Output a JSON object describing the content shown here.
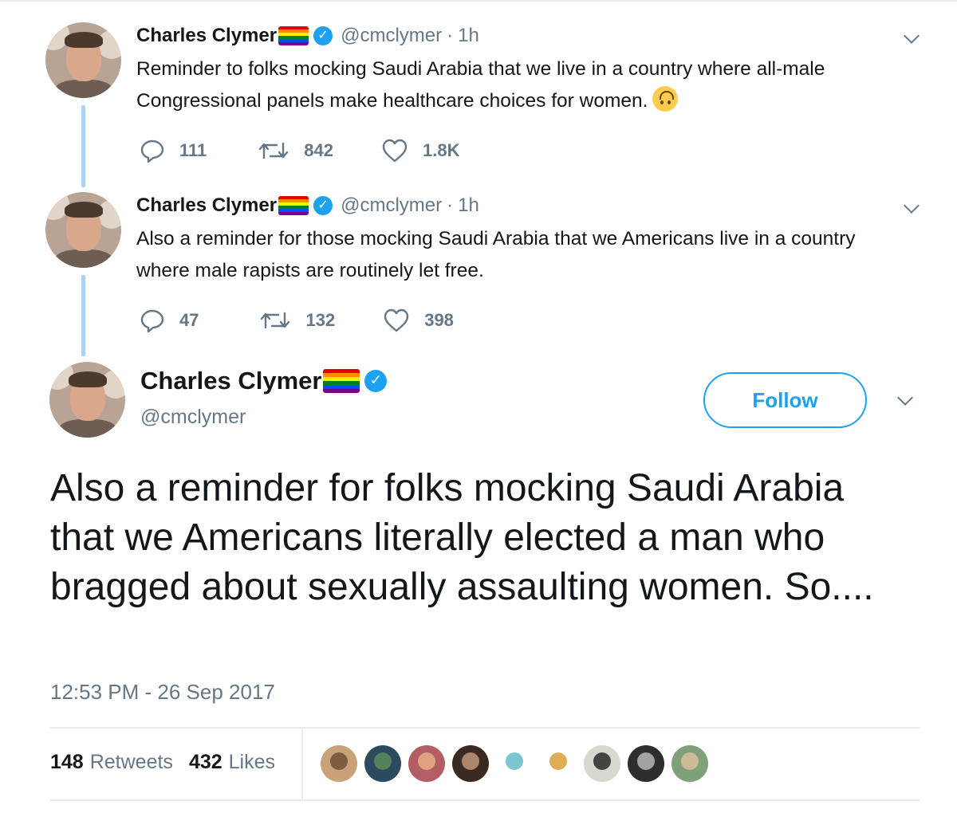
{
  "thread": [
    {
      "name": "Charles Clymer",
      "handle": "@cmclymer",
      "time": "1h",
      "text": "Reminder to folks mocking Saudi Arabia that we live in a country where all-male Congressional panels make healthcare choices for women.",
      "replies": "111",
      "retweets": "842",
      "likes": "1.8K"
    },
    {
      "name": "Charles Clymer",
      "handle": "@cmclymer",
      "time": "1h",
      "text": "Also a reminder for those mocking Saudi Arabia that we Americans live in a country where male rapists are routinely let free.",
      "replies": "47",
      "retweets": "132",
      "likes": "398"
    }
  ],
  "main": {
    "name": "Charles Clymer",
    "handle": "@cmclymer",
    "follow_label": "Follow",
    "text": "Also a reminder for folks mocking Saudi Arabia that we Americans literally elected a man who bragged about sexually assaulting women. So....",
    "timestamp": "12:53 PM - 26 Sep 2017",
    "retweet_count": "148",
    "retweet_label": "Retweets",
    "like_count": "432",
    "like_label": "Likes"
  },
  "icons": {
    "reply": "reply-icon",
    "retweet": "retweet-icon",
    "like": "heart-icon",
    "verified": "verified-badge-icon",
    "menu": "chevron-down-icon",
    "emoji": "upside-down-face-emoji"
  },
  "colors": {
    "accent": "#1da1f2",
    "muted": "#657786",
    "thread_line": "#a9d3f5"
  },
  "likers": [
    {
      "bg": "#c9a27a",
      "fg": "#6b4b33"
    },
    {
      "bg": "#2b4a5e",
      "fg": "#5c8e5a"
    },
    {
      "bg": "#b35d64",
      "fg": "#e8b487"
    },
    {
      "bg": "#3a2a22",
      "fg": "#c89d7f"
    },
    {
      "bg": "#ffffff",
      "fg": "#5bb7c4"
    },
    {
      "bg": "#ffffff",
      "fg": "#d49a2a"
    },
    {
      "bg": "#d8d8d0",
      "fg": "#1e1e1e"
    },
    {
      "bg": "#2e2e2e",
      "fg": "#bfbfbf"
    },
    {
      "bg": "#7fa17a",
      "fg": "#e0c0a0"
    }
  ]
}
